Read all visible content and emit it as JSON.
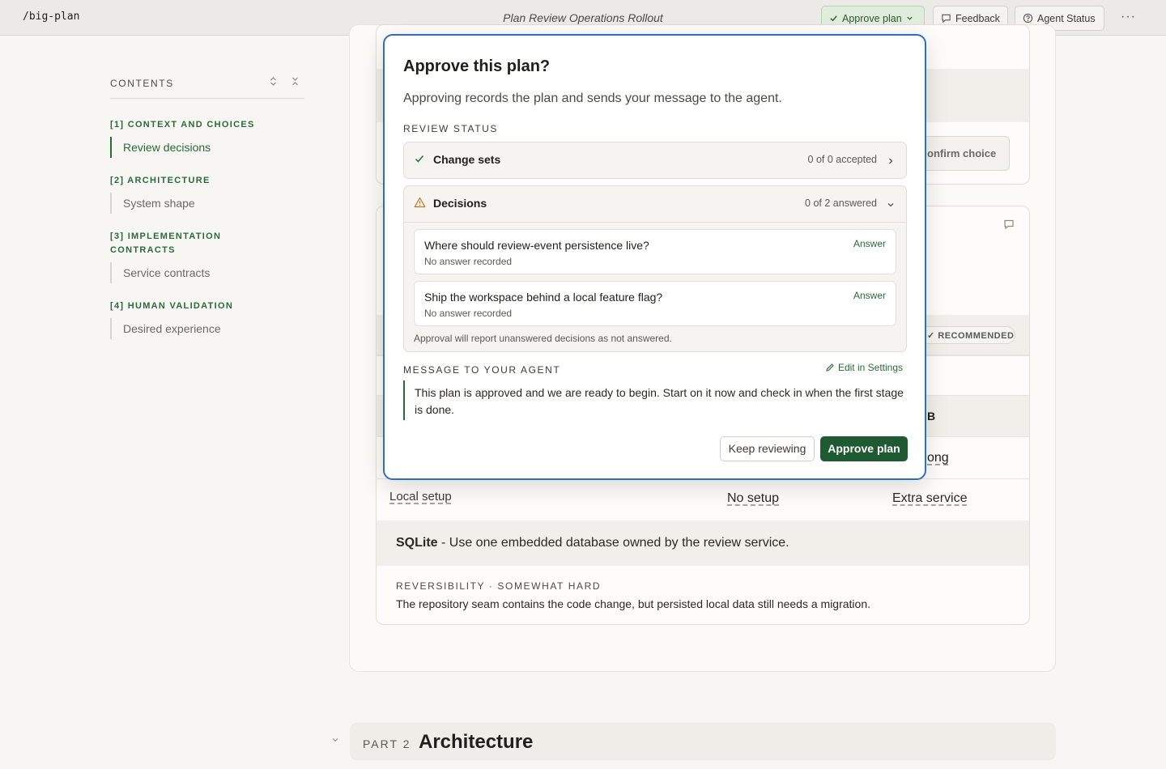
{
  "topbar": {
    "path": "/big-plan",
    "title": "Plan Review Operations Rollout",
    "approve_label": "Approve plan",
    "feedback_label": "Feedback",
    "status_label": "Agent Status",
    "more_label": "···"
  },
  "toc": {
    "title": "CONTENTS",
    "sections": [
      {
        "label": "[1] CONTEXT AND CHOICES",
        "item": "Review decisions"
      },
      {
        "label": "[2] ARCHITECTURE",
        "item": "System shape"
      },
      {
        "label": "[3] IMPLEMENTATION CONTRACTS",
        "item": "Service contracts"
      },
      {
        "label": "[4] HUMAN VALIDATION",
        "item": "Desired experience"
      }
    ]
  },
  "background": {
    "confirm_choice": "onfirm choice",
    "recommended": "✓ RECOMMENDED",
    "fragment_b": "B",
    "fragment_ong": "ong",
    "local_setup": "Local setup",
    "no_setup": "No setup",
    "extra_service": "Extra service",
    "sqlite_name": "SQLite",
    "sqlite_desc": " - Use one embedded database owned by the review service.",
    "reversibility_label": "REVERSIBILITY · SOMEWHAT HARD",
    "reversibility_text": "The repository seam contains the code change, but persisted local data still needs a migration.",
    "part_label": "PART 2",
    "part_title": "Architecture"
  },
  "modal": {
    "title": "Approve this plan?",
    "subtitle": "Approving records the plan and sends your message to the agent.",
    "review_status_label": "REVIEW STATUS",
    "change_sets": {
      "name": "Change sets",
      "count": "0 of 0 accepted"
    },
    "decisions": {
      "name": "Decisions",
      "count": "0 of 2 answered",
      "items": [
        {
          "question": "Where should review-event persistence live?",
          "status": "No answer recorded",
          "action": "Answer"
        },
        {
          "question": "Ship the workspace behind a local feature flag?",
          "status": "No answer recorded",
          "action": "Answer"
        }
      ],
      "note": "Approval will report unanswered decisions as not answered."
    },
    "message_label": "MESSAGE TO YOUR AGENT",
    "edit_settings": "Edit in Settings",
    "message": "This plan is approved and we are ready to begin. Start on it now and check in when the first stage is done.",
    "keep_reviewing": "Keep reviewing",
    "approve": "Approve plan"
  },
  "colors": {
    "accent_green": "#2b6a3b",
    "approve_button": "#1f5a32",
    "modal_border": "#2f6fb4",
    "warning": "#b8772a"
  }
}
